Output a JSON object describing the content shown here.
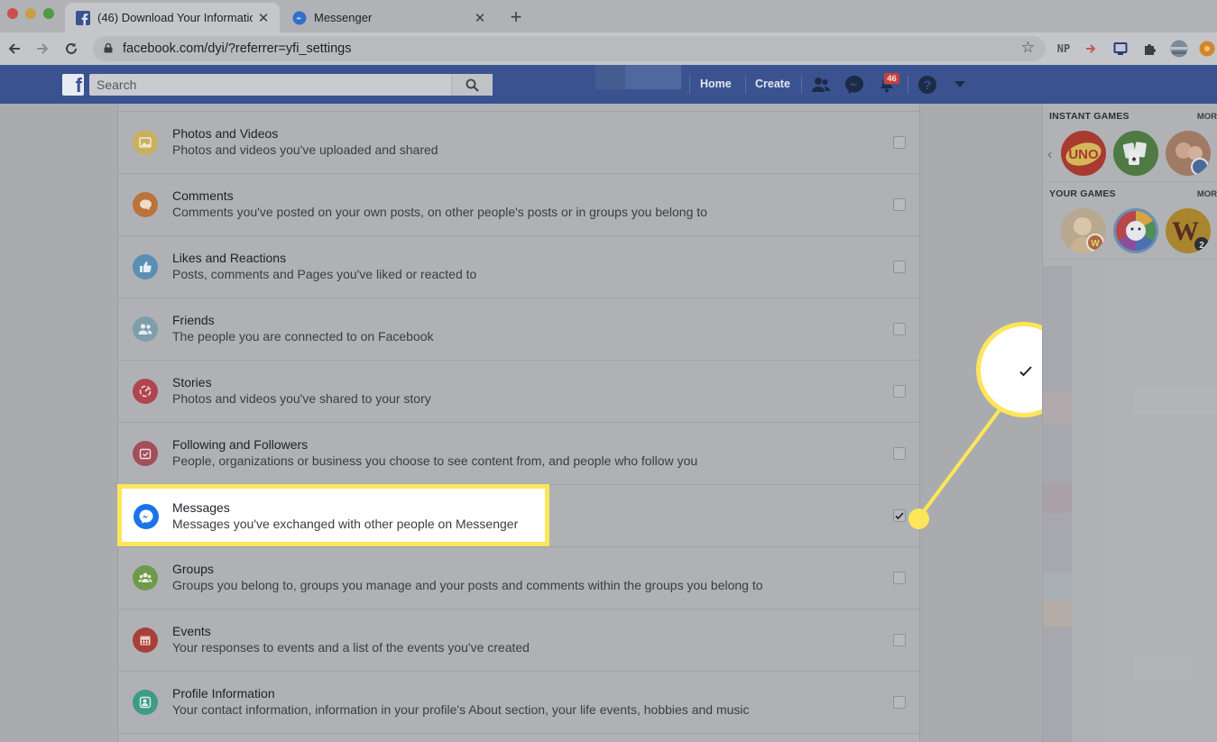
{
  "browser": {
    "tabs": [
      {
        "title": "(46) Download Your Informatio",
        "active": true
      },
      {
        "title": "Messenger",
        "active": false
      }
    ],
    "url": "facebook.com/dyi/?referrer=yfi_settings",
    "extensions": {
      "np_label": "NP"
    }
  },
  "facebook": {
    "search_placeholder": "Search",
    "nav": {
      "home": "Home",
      "create": "Create"
    },
    "notification_count": "46"
  },
  "info_categories": [
    {
      "title": "Photos and Videos",
      "description": "Photos and videos you've uploaded and shared",
      "checked": false,
      "icon": "photo-icon",
      "color": "#c9b060"
    },
    {
      "title": "Comments",
      "description": "Comments you've posted on your own posts, on other people's posts or in groups you belong to",
      "checked": false,
      "icon": "comment-icon",
      "color": "#b8743a"
    },
    {
      "title": "Likes and Reactions",
      "description": "Posts, comments and Pages you've liked or reacted to",
      "checked": false,
      "icon": "thumbs-up-icon",
      "color": "#5a8fb3"
    },
    {
      "title": "Friends",
      "description": "The people you are connected to on Facebook",
      "checked": false,
      "icon": "friends-icon",
      "color": "#7f9eac"
    },
    {
      "title": "Stories",
      "description": "Photos and videos you've shared to your story",
      "checked": false,
      "icon": "stories-icon",
      "color": "#b04451"
    },
    {
      "title": "Following and Followers",
      "description": "People, organizations or business you choose to see content from, and people who follow you",
      "checked": false,
      "icon": "following-icon",
      "color": "#a24f5a"
    },
    {
      "title": "Messages",
      "description": "Messages you've exchanged with other people on Messenger",
      "checked": true,
      "icon": "messenger-icon",
      "color": "#1a73e8"
    },
    {
      "title": "Groups",
      "description": "Groups you belong to, groups you manage and your posts and comments within the groups you belong to",
      "checked": false,
      "icon": "groups-icon",
      "color": "#6f9a4a"
    },
    {
      "title": "Events",
      "description": "Your responses to events and a list of the events you've created",
      "checked": false,
      "icon": "calendar-icon",
      "color": "#a84038"
    },
    {
      "title": "Profile Information",
      "description": "Your contact information, information in your profile's About section, your life events, hobbies and music",
      "checked": false,
      "icon": "profile-icon",
      "color": "#3f9a86"
    }
  ],
  "sidebar": {
    "instant_games": "INSTANT GAMES",
    "your_games": "YOUR GAMES",
    "more": "MOR",
    "instant_game_icons": [
      "uno-game-icon",
      "solitaire-game-icon",
      "family-game-icon"
    ],
    "your_game_icons": [
      "word-game-icon",
      "trivia-game-icon",
      "words-with-friends-icon"
    ]
  },
  "colors": {
    "facebook_blue": "#3b5998",
    "highlight_yellow": "#fde65a",
    "messenger_blue": "#1a73e8"
  }
}
